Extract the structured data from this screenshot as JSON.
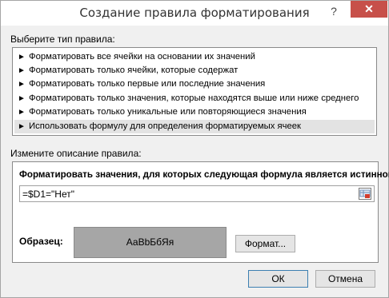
{
  "window": {
    "title": "Создание правила форматирования",
    "help_glyph": "?",
    "close_glyph": "✕"
  },
  "rule_type": {
    "label": "Выберите тип правила:",
    "items": [
      {
        "label": "Форматировать все ячейки на основании их значений",
        "selected": false
      },
      {
        "label": "Форматировать только ячейки, которые содержат",
        "selected": false
      },
      {
        "label": "Форматировать только первые или последние значения",
        "selected": false
      },
      {
        "label": "Форматировать только значения, которые находятся выше или ниже среднего",
        "selected": false
      },
      {
        "label": "Форматировать только уникальные или повторяющиеся значения",
        "selected": false
      },
      {
        "label": "Использовать формулу для определения форматируемых ячеек",
        "selected": true
      }
    ],
    "arrow_glyph": "►"
  },
  "description": {
    "label": "Измените описание правила:",
    "formula_label": "Форматировать значения, для которых следующая формула является истинной:",
    "formula_value": "=$D1=\"Нет\"",
    "sample_label": "Образец:",
    "sample_text": "АаВbБбЯя",
    "format_button": "Формат..."
  },
  "buttons": {
    "ok": "ОК",
    "cancel": "Отмена"
  },
  "colors": {
    "close_button": "#c7504a",
    "sample_fill": "#a6a6a6",
    "selected_item": "#e3e3e3"
  }
}
